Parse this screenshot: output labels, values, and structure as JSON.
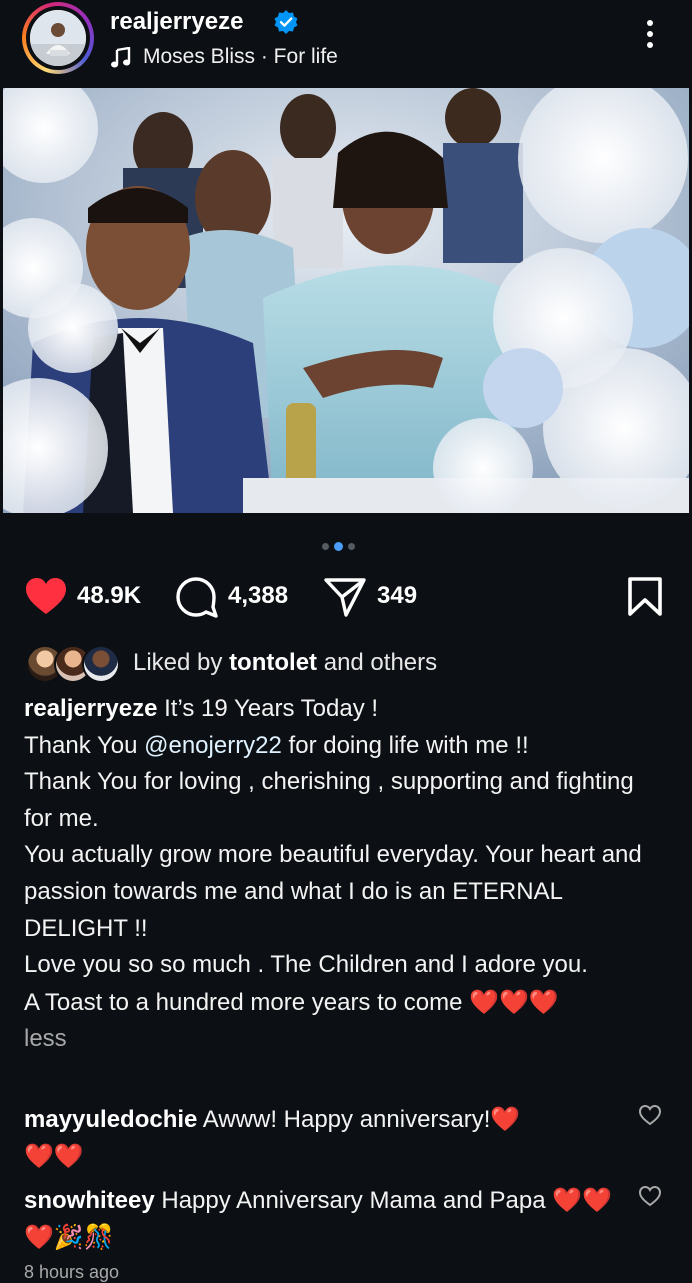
{
  "post": {
    "username": "realjerryeze",
    "music": "Moses Bliss · For life",
    "likes": "48.9K",
    "comments_count": "4,388",
    "shares": "349",
    "liked_by_prefix": "Liked by",
    "liked_by_user": "tontolet",
    "liked_by_suffix": "and others",
    "caption": {
      "user": "realjerryeze",
      "line1": "It’s 19 Years Today !",
      "line2_pre": "Thank You",
      "mention": "@enojerry22",
      "line2_post": "for doing life with me !!",
      "line3": "Thank You for loving , cherishing , supporting and fighting for me.",
      "line4": "You actually grow more beautiful everyday. Your heart and passion towards me and what I do is an ETERNAL DELIGHT !!",
      "line5": "Love you so so much . The Children and I adore you.",
      "line6": "A Toast to a hundred more years to come",
      "less": "less"
    },
    "time": "8 hours ago"
  },
  "comments": [
    {
      "user": "mayyuledochie",
      "text": "Awww! Happy anniversary!"
    },
    {
      "user": "snowhiteey",
      "text": "Happy Anniversary Mama and Papa"
    }
  ],
  "colors": {
    "background": "#0c1014",
    "like_red": "#ff3040",
    "verified_blue": "#0095f6",
    "carousel_active": "#4a9df8"
  },
  "icons": [
    "verified-badge-icon",
    "music-note-icon",
    "more-options-icon",
    "heart-icon",
    "comment-icon",
    "share-icon",
    "bookmark-icon",
    "comment-like-icon"
  ]
}
